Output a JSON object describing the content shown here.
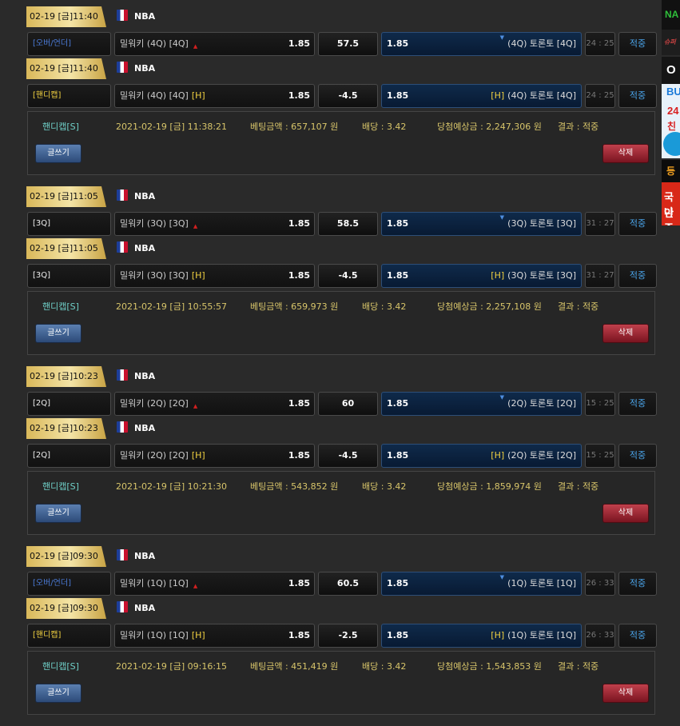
{
  "colors": {
    "accent_blue": "#4aa3e8",
    "gold": "#d8c56a",
    "delete_red": "#a02830",
    "away_bg": "#0f2a4a"
  },
  "side_banners": {
    "b1": "NA",
    "b2": "슈퍼",
    "b3": "O",
    "b4_top": "BU",
    "b4_mid1": "24",
    "b4_mid2": "친추",
    "b5": "등",
    "b6_line1": "국나",
    "b6_line2": "인증"
  },
  "groups": [
    {
      "rows": [
        {
          "date": "02-19 [금]11:40",
          "league": "NBA",
          "type": "[오버/언더]",
          "type_color": "blue",
          "home": "밀워키 (4Q) [4Q]",
          "home_marker": "▲",
          "home_odds": "1.85",
          "line": "57.5",
          "away_odds": "1.85",
          "away": "(4Q) 토론토 [4Q]",
          "away_prefix": "",
          "time": "24 : 25",
          "status": "적중"
        },
        {
          "date": "02-19 [금]11:40",
          "league": "NBA",
          "type": "[핸디캡]",
          "type_color": "yellow",
          "home": "밀워키 (4Q) [4Q]",
          "home_marker": "[H]",
          "home_odds": "1.85",
          "line": "-4.5",
          "away_odds": "1.85",
          "away": "(4Q) 토론토 [4Q]",
          "away_prefix": "[H]",
          "time": "24 : 25",
          "status": "적중"
        }
      ],
      "summary": {
        "type": "핸디캡[S]",
        "datetime": "2021-02-19 [금] 11:38:21",
        "bet": "베팅금액 : 657,107 원",
        "rate": "배당 : 3.42",
        "expected": "당첨예상금 : 2,247,306 원",
        "result": "결과 : 적중",
        "write": "글쓰기",
        "delete": "삭제"
      }
    },
    {
      "rows": [
        {
          "date": "02-19 [금]11:05",
          "league": "NBA",
          "type": "[3Q]",
          "type_color": "white",
          "home": "밀워키 (3Q) [3Q]",
          "home_marker": "▲",
          "home_odds": "1.85",
          "line": "58.5",
          "away_odds": "1.85",
          "away": "(3Q) 토론토 [3Q]",
          "away_prefix": "",
          "time": "31 : 27",
          "status": "적중"
        },
        {
          "date": "02-19 [금]11:05",
          "league": "NBA",
          "type": "[3Q]",
          "type_color": "white",
          "home": "밀워키 (3Q) [3Q]",
          "home_marker": "[H]",
          "home_odds": "1.85",
          "line": "-4.5",
          "away_odds": "1.85",
          "away": "(3Q) 토론토 [3Q]",
          "away_prefix": "[H]",
          "time": "31 : 27",
          "status": "적중"
        }
      ],
      "summary": {
        "type": "핸디캡[S]",
        "datetime": "2021-02-19 [금] 10:55:57",
        "bet": "베팅금액 : 659,973 원",
        "rate": "배당 : 3.42",
        "expected": "당첨예상금 : 2,257,108 원",
        "result": "결과 : 적중",
        "write": "글쓰기",
        "delete": "삭제"
      }
    },
    {
      "rows": [
        {
          "date": "02-19 [금]10:23",
          "league": "NBA",
          "type": "[2Q]",
          "type_color": "white",
          "home": "밀워키 (2Q) [2Q]",
          "home_marker": "▲",
          "home_odds": "1.85",
          "line": "60",
          "away_odds": "1.85",
          "away": "(2Q) 토론토 [2Q]",
          "away_prefix": "",
          "time": "15 : 25",
          "status": "적중"
        },
        {
          "date": "02-19 [금]10:23",
          "league": "NBA",
          "type": "[2Q]",
          "type_color": "white",
          "home": "밀워키 (2Q) [2Q]",
          "home_marker": "[H]",
          "home_odds": "1.85",
          "line": "-4.5",
          "away_odds": "1.85",
          "away": "(2Q) 토론토 [2Q]",
          "away_prefix": "[H]",
          "time": "15 : 25",
          "status": "적중"
        }
      ],
      "summary": {
        "type": "핸디캡[S]",
        "datetime": "2021-02-19 [금] 10:21:30",
        "bet": "베팅금액 : 543,852 원",
        "rate": "배당 : 3.42",
        "expected": "당첨예상금 : 1,859,974 원",
        "result": "결과 : 적중",
        "write": "글쓰기",
        "delete": "삭제"
      }
    },
    {
      "rows": [
        {
          "date": "02-19 [금]09:30",
          "league": "NBA",
          "type": "[오버/언더]",
          "type_color": "blue",
          "home": "밀워키 (1Q) [1Q]",
          "home_marker": "▲",
          "home_odds": "1.85",
          "line": "60.5",
          "away_odds": "1.85",
          "away": "(1Q) 토론토 [1Q]",
          "away_prefix": "",
          "time": "26 : 33",
          "status": "적중"
        },
        {
          "date": "02-19 [금]09:30",
          "league": "NBA",
          "type": "[핸디캡]",
          "type_color": "yellow",
          "home": "밀워키 (1Q) [1Q]",
          "home_marker": "[H]",
          "home_odds": "1.85",
          "line": "-2.5",
          "away_odds": "1.85",
          "away": "(1Q) 토론토 [1Q]",
          "away_prefix": "[H]",
          "time": "26 : 33",
          "status": "적중"
        }
      ],
      "summary": {
        "type": "핸디캡[S]",
        "datetime": "2021-02-19 [금] 09:16:15",
        "bet": "베팅금액 : 451,419 원",
        "rate": "배당 : 3.42",
        "expected": "당첨예상금 : 1,543,853 원",
        "result": "결과 : 적중",
        "write": "글쓰기",
        "delete": "삭제"
      }
    }
  ]
}
